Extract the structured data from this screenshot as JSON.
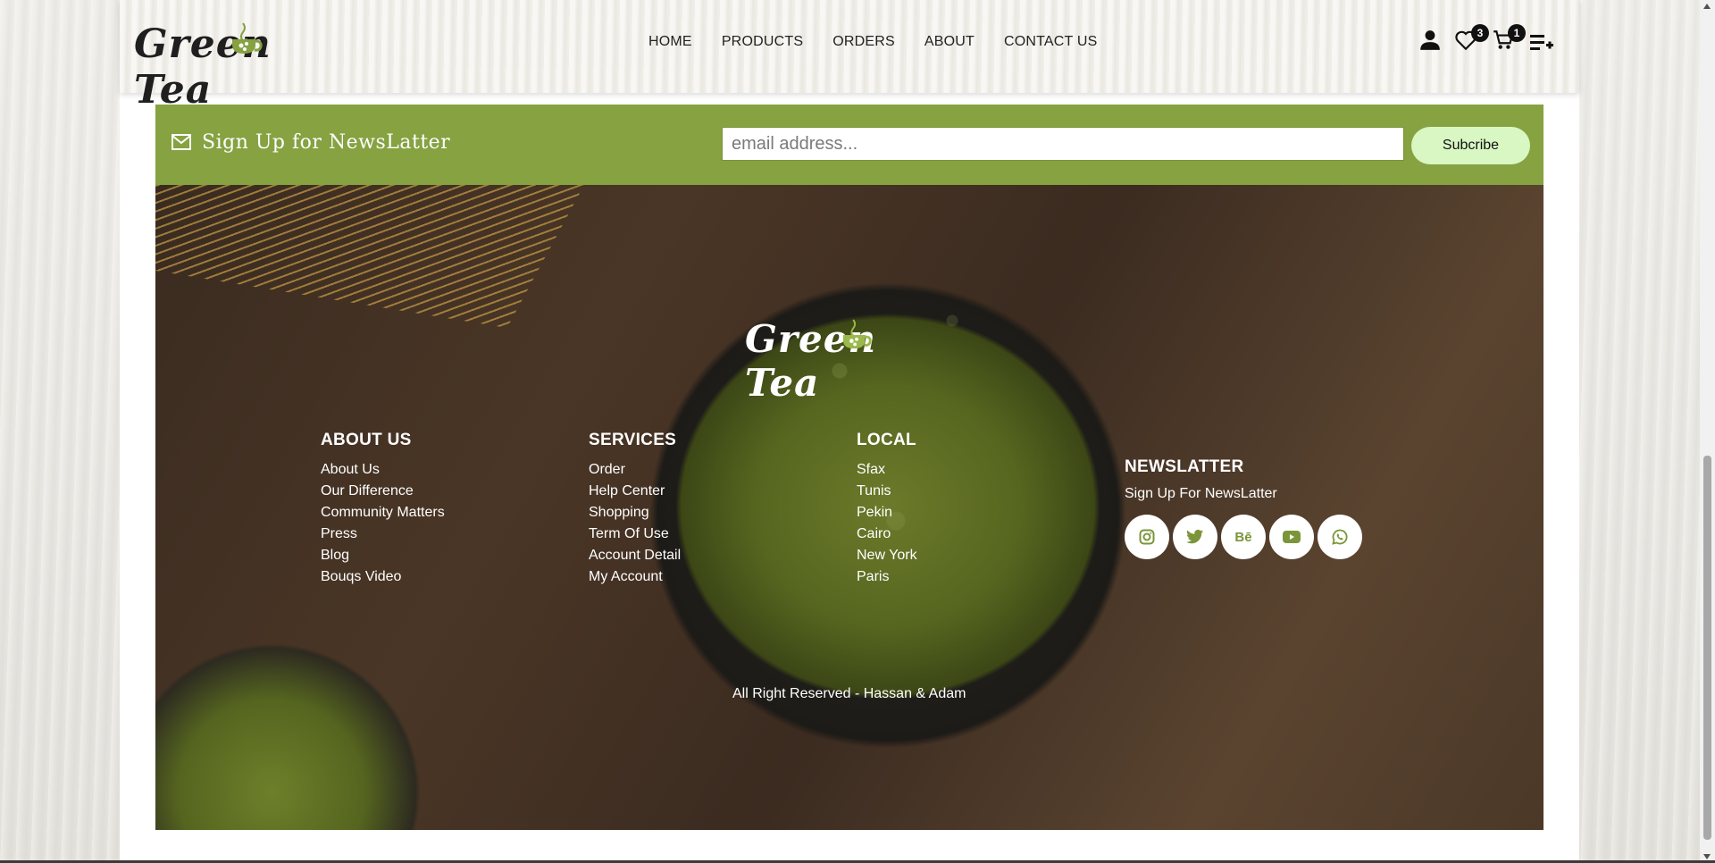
{
  "header": {
    "logo_text": "Green Tea",
    "nav": [
      "HOME",
      "PRODUCTS",
      "ORDERS",
      "ABOUT",
      "CONTACT US"
    ],
    "icons": {
      "account": "user-icon",
      "wishlist": "heart-icon",
      "cart": "cart-icon",
      "menu": "playlist-add-icon"
    },
    "wishlist_count": "3",
    "cart_count": "1"
  },
  "newsletter_bar": {
    "title": "Sign Up for NewsLatter",
    "email_placeholder": "email address...",
    "button_label": "Subcribe",
    "bar_color": "#86a241"
  },
  "footer": {
    "logo_text": "Green Tea",
    "about": {
      "heading": "ABOUT US",
      "links": [
        "About Us",
        "Our Difference",
        "Community Matters",
        "Press",
        "Blog",
        "Bouqs Video"
      ]
    },
    "services": {
      "heading": "SERVICES",
      "links": [
        "Order",
        "Help Center",
        "Shopping",
        "Term Of Use",
        "Account Detail",
        "My Account"
      ]
    },
    "local": {
      "heading": "LOCAL",
      "links": [
        "Sfax",
        "Tunis",
        "Pekin",
        "Cairo",
        "New York",
        "Paris"
      ]
    },
    "newsletter": {
      "heading": "NEWSLATTER",
      "text": "Sign Up For NewsLatter",
      "socials": [
        "instagram-icon",
        "twitter-icon",
        "behance-icon",
        "youtube-icon",
        "whatsapp-icon"
      ]
    },
    "copyright": "All Right Reserved - Hassan & Adam"
  }
}
